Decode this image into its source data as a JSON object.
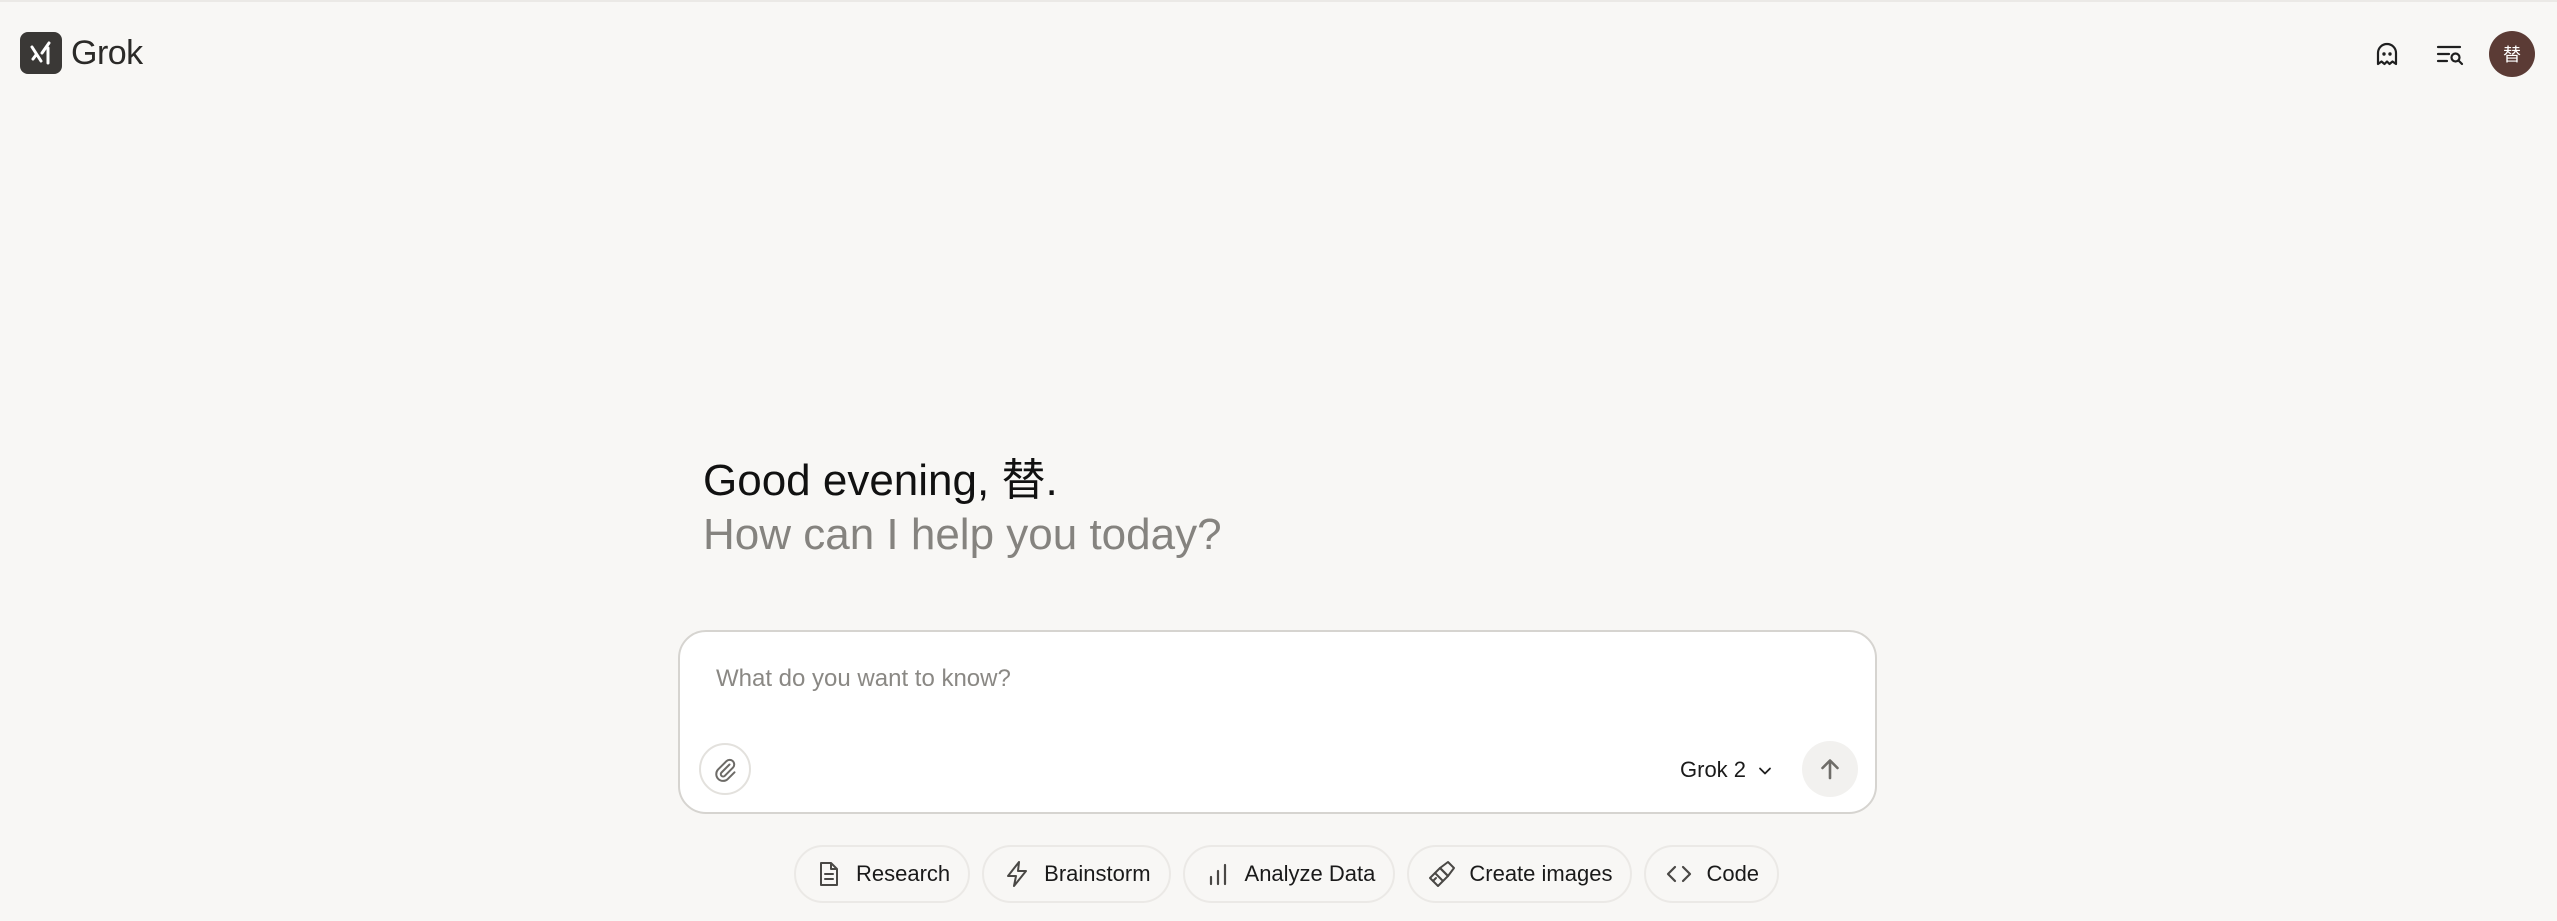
{
  "app": {
    "name": "Grok"
  },
  "header": {
    "icons": [
      "ghost-icon",
      "history-search-icon"
    ],
    "avatar_initial": "替"
  },
  "greeting": {
    "line1": "Good evening, 替.",
    "line2": "How can I help you today?"
  },
  "composer": {
    "placeholder": "What do you want to know?",
    "value": "",
    "model": "Grok 2"
  },
  "chips": [
    {
      "label": "Research",
      "icon": "document-icon"
    },
    {
      "label": "Brainstorm",
      "icon": "lightning-icon"
    },
    {
      "label": "Analyze Data",
      "icon": "bar-chart-icon"
    },
    {
      "label": "Create images",
      "icon": "paintbrush-icon"
    },
    {
      "label": "Code",
      "icon": "code-brackets-icon"
    }
  ],
  "colors": {
    "background": "#f8f7f5",
    "avatar": "#5b3b35",
    "logo": "#3a3836",
    "secondary_text": "#85837f"
  }
}
